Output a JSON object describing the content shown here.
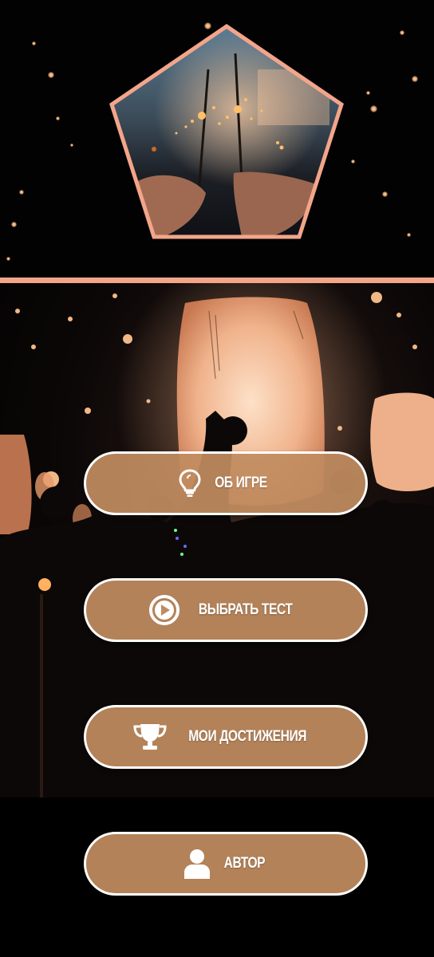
{
  "colors": {
    "accent": "#f3a58a",
    "button_fill": "#c18c60",
    "button_border": "#ffffff",
    "button_text": "#ffffff",
    "background": "#000000"
  },
  "header": {
    "image_description_icon": "sparklers-image"
  },
  "menu": {
    "about": {
      "label": "ОБ ИГРЕ",
      "icon": "lightbulb-icon"
    },
    "choose_test": {
      "label": "ВЫБРАТЬ ТЕСТ",
      "icon": "play-circle-icon"
    },
    "achievements": {
      "label": "МОИ ДОСТИЖЕНИЯ",
      "icon": "trophy-icon"
    },
    "author": {
      "label": "АВТОР",
      "icon": "user-icon"
    }
  }
}
